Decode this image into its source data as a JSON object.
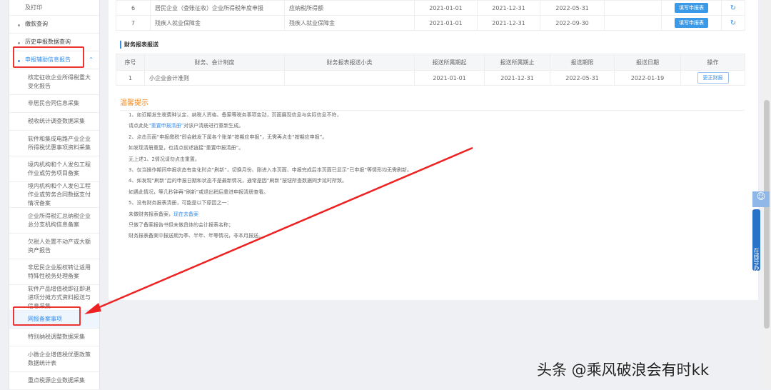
{
  "sidebar": {
    "items": [
      {
        "label": "及打印",
        "type": "sub"
      },
      {
        "label": "缴款查询",
        "type": "top"
      },
      {
        "label": "历史申报数据查询",
        "type": "top"
      },
      {
        "label": "申报辅助信息报告",
        "type": "active"
      },
      {
        "label": "核定征收企业所得税重大变化报告",
        "type": "sub"
      },
      {
        "label": "非居民合同信息采集",
        "type": "sub"
      },
      {
        "label": "税收统计调查数据采集",
        "type": "sub"
      },
      {
        "label": "软件和集成电路产业企业所得税优惠事项资料采集",
        "type": "sub"
      },
      {
        "label": "境内机构和个人发包工程作业或劳务项目备案",
        "type": "sub"
      },
      {
        "label": "境内机构和个人发包工程作业或劳务合同数据支付情况备案",
        "type": "sub"
      },
      {
        "label": "企业所得税汇总纳税企业总分支机构信息备案",
        "type": "sub"
      },
      {
        "label": "欠税人处置不动产或大额资产报告",
        "type": "sub"
      },
      {
        "label": "非居民企业股权转让适用特殊性税务处理备案",
        "type": "sub"
      },
      {
        "label": "软件产品增值税即征即退进项分摊方式资料报送与信息采集",
        "type": "sub"
      },
      {
        "label": "网报备案事项",
        "type": "sel"
      },
      {
        "label": "特别纳税调整数据采集",
        "type": "sub"
      },
      {
        "label": "小微企业增值税优惠政策数据统计表",
        "type": "sub"
      },
      {
        "label": "重点税源企业数据采集",
        "type": "sub"
      }
    ]
  },
  "declare_table": {
    "rows": [
      {
        "no": "6",
        "name": "居民企业（查账征收）企业所得税年度申报",
        "item": "应纳税所得额",
        "start": "2021-01-01",
        "end": "2021-12-31",
        "deadline": "2022-05-31",
        "date": "",
        "action": "填写申报表"
      },
      {
        "no": "7",
        "name": "残疾人就业保障金",
        "item": "残疾人就业保障金",
        "start": "2021-01-01",
        "end": "2021-12-31",
        "deadline": "2022-09-30",
        "date": "",
        "action": "填写申报表"
      }
    ]
  },
  "finance": {
    "title": "财务报表报送",
    "headers": [
      "序号",
      "财务、会计制度",
      "财务报表报送小类",
      "报送所属期起",
      "报送所属期止",
      "报送期限",
      "报送日期",
      "操作"
    ],
    "rows": [
      {
        "no": "1",
        "system": "小企业会计准则",
        "sub": "",
        "start": "2021-01-01",
        "end": "2021-12-31",
        "deadline": "2022-05-31",
        "date": "2022-01-19",
        "action": "更正财报"
      }
    ]
  },
  "tips": {
    "title": "温馨提示",
    "l1": "1、如近期发生税费种认定、纳税人资格、备案等税务事项变动，页面展现信息与实际信息不符，",
    "l2a": "请点此处",
    "l2b": "“重置申报清册”",
    "l2c": "对该户清册进行重新生成。",
    "l3": "2、点击页面“申报缴税”即会触发下属各个账单“按期应申报”，无需再点击“按期应申报”。",
    "l4": "如发现清册重复，也请点前述链接“重置申报清册”。",
    "l5": "无上述1、2情况请勿点击重置。",
    "l6": "3、仅当操作期间申报状态有变化时点“刷新”，切换月份、刚进入本页面、申报完成后本页面已显示“已申报”等情形均无需刷新。",
    "l7": "4、如发现“刷新”后的申报日期和状态不是最新情况，通常是因“刷新”按钮所查数据同步延时所致。",
    "l8": "如遇此情况，等几秒钟再“刷新”或退出稍后重进申报清册查看。",
    "l9": "5、没有财务报表清册，可能是以下原因之一：",
    "l10a": "未做财务报表备案，",
    "l10b": "现在去备案",
    "l11": "只做了备案报告书但未做具体的会计报表名称；",
    "l12": "财务报表备案中报送期为季、半年、年等情况，非本月报送。"
  },
  "helper": {
    "label": "在线导办"
  },
  "watermark": "头条 @乘风破浪会有时kk",
  "colors": {
    "accent": "#3a8ee6",
    "highlight": "#e33333",
    "tip": "#f08a24"
  }
}
